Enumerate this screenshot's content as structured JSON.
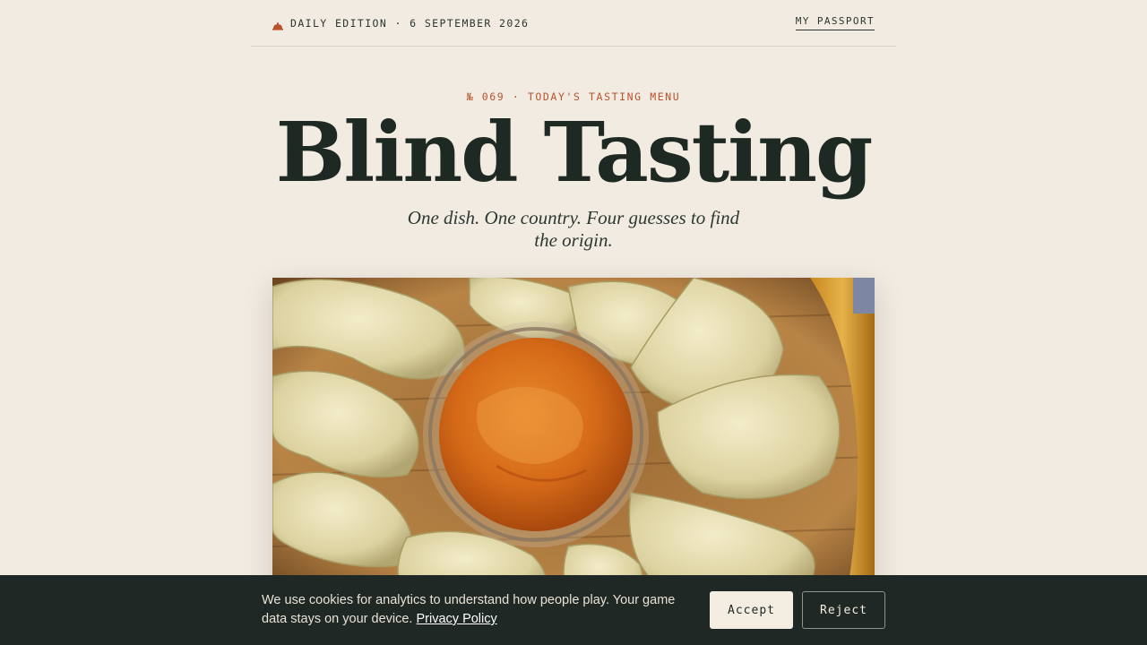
{
  "header": {
    "edition": "DAILY EDITION · 6 SEPTEMBER 2026",
    "edition_icon": "cloche-icon",
    "passport_link": "MY PASSPORT"
  },
  "hero": {
    "eyebrow": "№ 069 · TODAY'S TASTING MENU",
    "title": "Blind Tasting",
    "subtitle": "One dish. One country. Four guesses to find the origin."
  },
  "dish_image": {
    "subject": "steamed dumplings with orange dipping sauce in a bamboo steamer"
  },
  "cookie_banner": {
    "text": "We use cookies for analytics to understand how people play. Your game data stays on your device.",
    "link": "Privacy Policy",
    "accept_label": "Accept",
    "reject_label": "Reject"
  },
  "colors": {
    "background": "#f1ebe1",
    "accent": "#b8532e",
    "ink": "#1d2922",
    "banner": "#1f2824"
  }
}
